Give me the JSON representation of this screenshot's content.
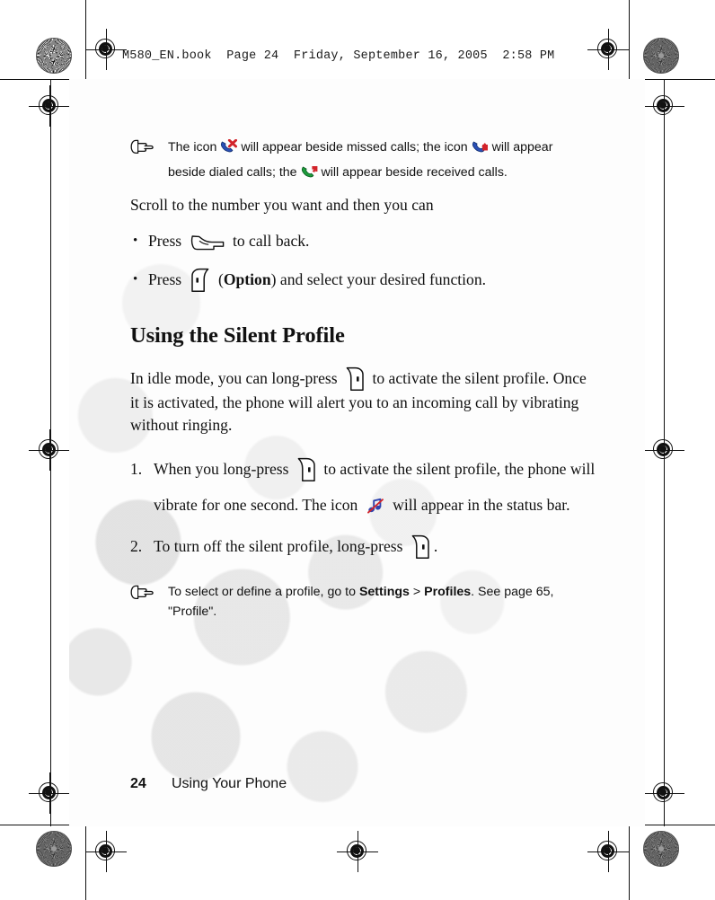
{
  "header": {
    "file_info": "M580_EN.book  Page 24  Friday, September 16, 2005  2:58 PM"
  },
  "notes": [
    {
      "icon": "pointing-hand-icon",
      "line1_a": "The icon",
      "icon1": "missed-call-icon",
      "line1_b": "will appear beside missed calls; the icon",
      "icon2": "dialed-call-icon",
      "line1_c": "will appear",
      "line2_a": "beside dialed calls; the",
      "icon3": "received-call-icon",
      "line2_b": "will appear beside received calls."
    }
  ],
  "body": {
    "intro": "Scroll to the number you want and then you can",
    "bullets": [
      {
        "pre": "Press",
        "icon": "call-key-icon",
        "post": "to call back."
      },
      {
        "pre": "Press",
        "icon": "left-soft-key-icon",
        "paren_open": "(",
        "bold": "Option",
        "paren_close": ")",
        "post": "and select your desired function."
      }
    ],
    "section_title": "Using the Silent Profile",
    "paragraph": {
      "a": "In idle mode, you can long-press",
      "icon": "right-soft-key-icon",
      "b": "to activate the silent profile. Once it is activated, the phone will alert you to an incoming call by vibrating without ringing."
    },
    "steps": [
      {
        "a": "When you long-press",
        "icon1": "right-soft-key-icon",
        "b": "to activate the silent profile, the phone will vibrate for one second. The icon",
        "icon2": "silent-mute-icon",
        "c": "will appear in the status bar."
      },
      {
        "a": "To turn off the silent profile, long-press",
        "icon1": "right-soft-key-icon",
        "b": "."
      }
    ],
    "note_bottom": {
      "icon": "pointing-hand-icon",
      "a": "To select or define a profile, go to",
      "b1": "Settings",
      "sep": ">",
      "b2": "Profiles",
      "c": ". See page 65,",
      "line2": "\"Profile\"."
    }
  },
  "footer": {
    "page_number": "24",
    "chapter": "Using Your Phone"
  },
  "colors": {
    "text": "#111111",
    "missed_call_phone": "#2a4fb5",
    "missed_call_mark": "#d2232a",
    "dialed_call_phone": "#2a4fb5",
    "dialed_call_mark": "#d2232a",
    "received_call_phone": "#1d9b3c",
    "received_call_mark": "#d2232a",
    "mute_note": "#2f43ae",
    "mute_slash": "#d2232a",
    "sheet_bg": "#fbfbfb"
  }
}
